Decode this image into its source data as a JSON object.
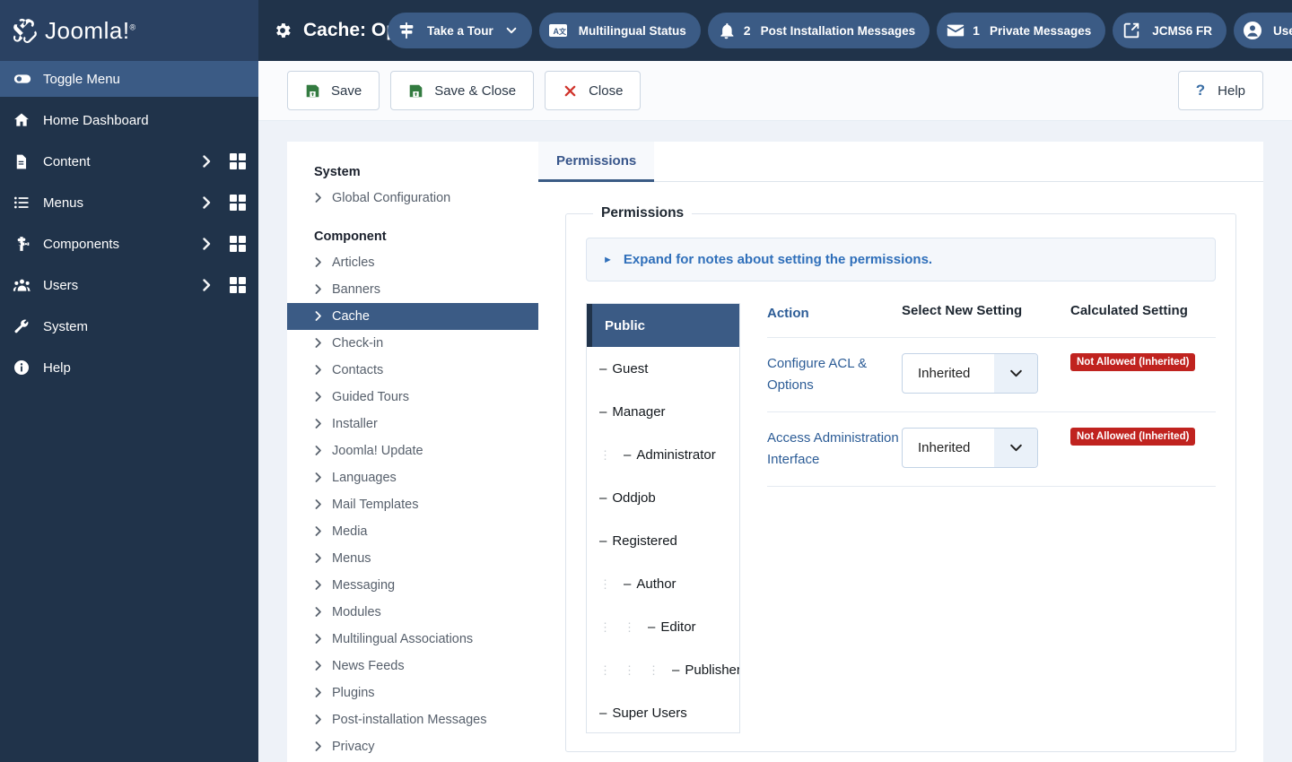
{
  "header": {
    "brand": "Joomla!",
    "brand_sup": "®",
    "title": "Cache: Options",
    "gear_icon": "gear-icon",
    "pills": [
      {
        "icon": "signpost-icon",
        "label": "Take a Tour",
        "count": "",
        "caret": true
      },
      {
        "icon": "multilingual-icon",
        "label": "Multilingual Status",
        "count": "",
        "caret": false
      },
      {
        "icon": "bell-icon",
        "label": "Post Installation Messages",
        "count": "2",
        "caret": false
      },
      {
        "icon": "envelope-icon",
        "label": "Private Messages",
        "count": "1",
        "caret": false
      },
      {
        "icon": "external-link-icon",
        "label": "JCMS6 FR",
        "count": "",
        "caret": false
      },
      {
        "icon": "user-circle-icon",
        "label": "User Menu",
        "count": "",
        "caret": true
      }
    ],
    "overflow_label": "more-options"
  },
  "sidebar": {
    "toggle": {
      "label": "Toggle Menu",
      "icon": "toggle-icon"
    },
    "items": [
      {
        "label": "Home Dashboard",
        "icon": "home-icon",
        "arrow": false,
        "grid": false
      },
      {
        "label": "Content",
        "icon": "document-icon",
        "arrow": true,
        "grid": true
      },
      {
        "label": "Menus",
        "icon": "list-icon",
        "arrow": true,
        "grid": true
      },
      {
        "label": "Components",
        "icon": "puzzle-icon",
        "arrow": true,
        "grid": true
      },
      {
        "label": "Users",
        "icon": "users-icon",
        "arrow": true,
        "grid": true
      },
      {
        "label": "System",
        "icon": "wrench-icon",
        "arrow": false,
        "grid": false
      },
      {
        "label": "Help",
        "icon": "info-icon",
        "arrow": false,
        "grid": false
      }
    ]
  },
  "toolbar": {
    "buttons": [
      {
        "label": "Save",
        "icon": "save-icon"
      },
      {
        "label": "Save & Close",
        "icon": "save-icon"
      },
      {
        "label": "Close",
        "icon": "x-icon"
      }
    ],
    "help": {
      "label": "Help",
      "icon": "question-icon",
      "glyph": "?"
    }
  },
  "confignav": {
    "groups": [
      {
        "heading": "System",
        "items": [
          {
            "label": "Global Configuration",
            "active": false
          }
        ]
      },
      {
        "heading": "Component",
        "items": [
          {
            "label": "Articles",
            "active": false
          },
          {
            "label": "Banners",
            "active": false
          },
          {
            "label": "Cache",
            "active": true
          },
          {
            "label": "Check-in",
            "active": false
          },
          {
            "label": "Contacts",
            "active": false
          },
          {
            "label": "Guided Tours",
            "active": false
          },
          {
            "label": "Installer",
            "active": false
          },
          {
            "label": "Joomla! Update",
            "active": false
          },
          {
            "label": "Languages",
            "active": false
          },
          {
            "label": "Mail Templates",
            "active": false
          },
          {
            "label": "Media",
            "active": false
          },
          {
            "label": "Menus",
            "active": false
          },
          {
            "label": "Messaging",
            "active": false
          },
          {
            "label": "Modules",
            "active": false
          },
          {
            "label": "Multilingual Associations",
            "active": false
          },
          {
            "label": "News Feeds",
            "active": false
          },
          {
            "label": "Plugins",
            "active": false
          },
          {
            "label": "Post-installation Messages",
            "active": false
          },
          {
            "label": "Privacy",
            "active": false
          }
        ]
      }
    ]
  },
  "main": {
    "tabs": [
      {
        "label": "Permissions",
        "active": true
      }
    ],
    "fieldset_legend": "Permissions",
    "notes_label": "Expand for notes about setting the permissions.",
    "notes_marker": "►",
    "groups": [
      {
        "label": "Public",
        "indent": 0,
        "active": true
      },
      {
        "label": "Guest",
        "indent": 0,
        "active": false
      },
      {
        "label": "Manager",
        "indent": 0,
        "active": false
      },
      {
        "label": "Administrator",
        "indent": 1,
        "active": false
      },
      {
        "label": "Oddjob",
        "indent": 0,
        "active": false
      },
      {
        "label": "Registered",
        "indent": 0,
        "active": false
      },
      {
        "label": "Author",
        "indent": 1,
        "active": false
      },
      {
        "label": "Editor",
        "indent": 2,
        "active": false
      },
      {
        "label": "Publisher",
        "indent": 3,
        "active": false
      },
      {
        "label": "Super Users",
        "indent": 0,
        "active": false
      }
    ],
    "group_dash": "–",
    "table": {
      "columns": [
        "Action",
        "Select New Setting",
        "Calculated Setting"
      ],
      "rows": [
        {
          "action": "Configure ACL & Options",
          "setting": "Inherited",
          "calculated": "Not Allowed (Inherited)"
        },
        {
          "action": "Access Administration Interface",
          "setting": "Inherited",
          "calculated": "Not Allowed (Inherited)"
        }
      ]
    }
  },
  "colors": {
    "header_bg": "#20334a",
    "brand_bg": "#2a4162",
    "accent_blue": "#3b5b85",
    "page_bg": "#eef2f8",
    "link_blue": "#2c5c96",
    "danger_red": "#c0231f",
    "save_green": "#337b40",
    "close_red": "#d0342c"
  }
}
